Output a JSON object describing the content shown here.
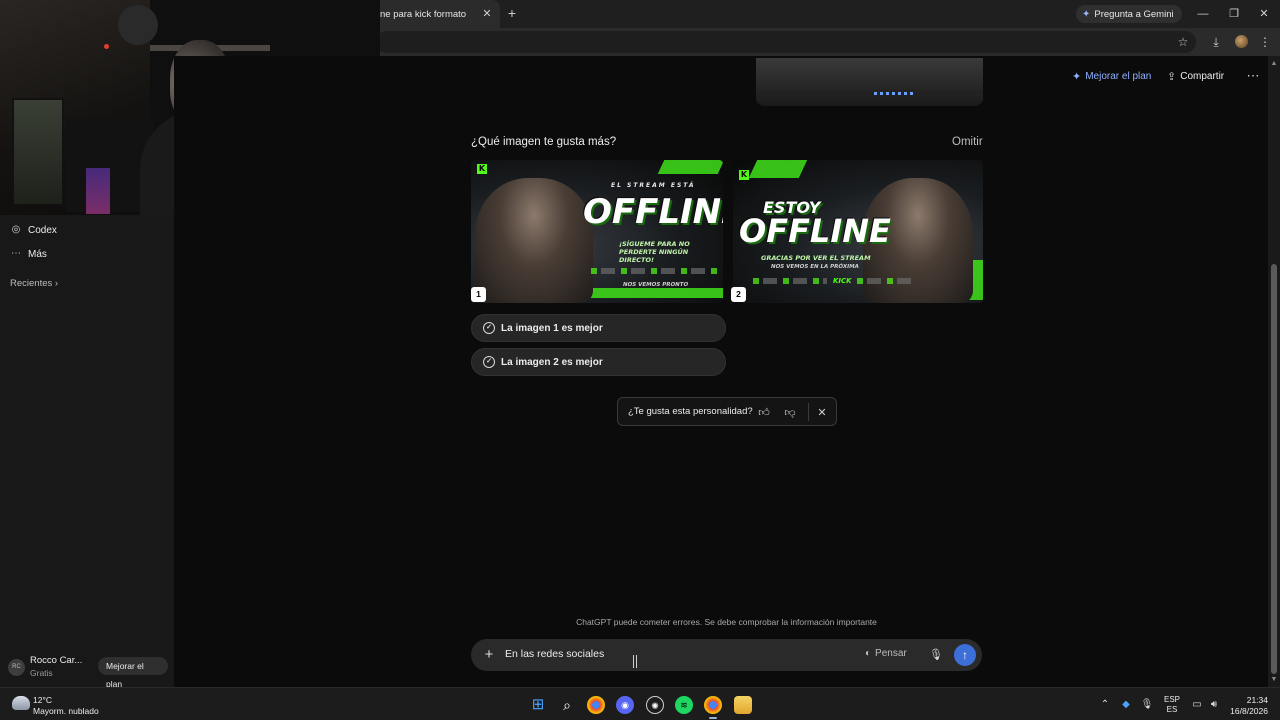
{
  "browser": {
    "tab_title": "ne para kick formato",
    "gemini_button": "Pregunta a Gemini"
  },
  "sidebar": {
    "items": [
      {
        "label": "Codex",
        "icon": "codex-icon"
      },
      {
        "label": "Más",
        "icon": "more-dots-icon"
      }
    ],
    "recents_label": "Recientes",
    "user": {
      "initials": "RC",
      "name": "Rocco Car...",
      "plan": "Gratis",
      "upgrade_label": "Mejorar el plan"
    }
  },
  "header": {
    "upgrade_label": "Mejorar el plan",
    "share_label": "Compartir"
  },
  "comparison": {
    "question": "¿Qué imagen te gusta más?",
    "skip_label": "Omitir",
    "images": [
      {
        "number": "1",
        "pretitle": "EL STREAM ESTÁ",
        "title": "OFFLINE",
        "subtitle": "¡SÍGUEME PARA NO PERDERTE NINGÚN DIRECTO!",
        "footer": "NOS VEMOS PRONTO"
      },
      {
        "number": "2",
        "pretitle": "ESTOY",
        "title": "OFFLINE",
        "subtitle": "GRACIAS POR VER EL STREAM",
        "footer": "NOS VEMOS EN LA PRÓXIMA",
        "brand": "KICK"
      }
    ],
    "choices": [
      "La imagen 1 es mejor",
      "La imagen 2 es mejor"
    ]
  },
  "feedback": {
    "prompt": "¿Te gusta esta personalidad?"
  },
  "composer": {
    "disclaimer": "ChatGPT puede cometer errores. Se debe comprobar la información importante",
    "input_value": "En las redes sociales",
    "think_label": "Pensar"
  },
  "taskbar": {
    "weather_temp": "12°C",
    "weather_desc": "Mayorm. nublado",
    "lang_top": "ESP",
    "lang_bottom": "ES",
    "time": "21:34",
    "date": "16/8/2026"
  },
  "colors": {
    "accent_blue": "#3d6fd8",
    "kick_green": "#53fc18",
    "background": "#0b0b0b"
  }
}
